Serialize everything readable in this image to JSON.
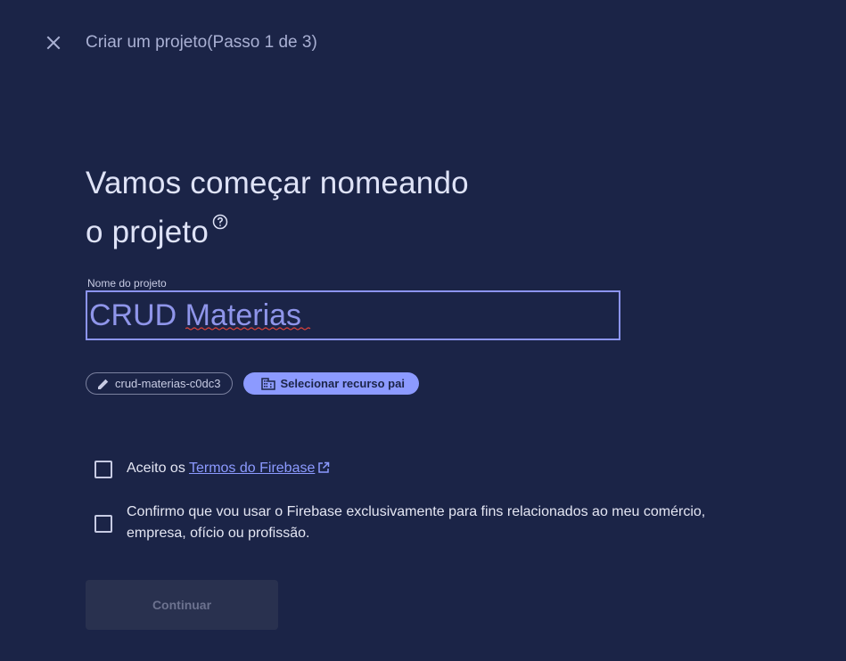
{
  "header": {
    "close_icon": "close-icon",
    "step_title": "Criar um projeto(Passo 1 de 3)"
  },
  "main": {
    "heading_line1": "Vamos começar nomeando",
    "heading_line2": "o projeto",
    "help_icon": "help-circle-icon",
    "project_name": {
      "label": "Nome do projeto",
      "value": "CRUD Materias"
    },
    "chips": {
      "project_id": "crud-materias-c0dc3",
      "project_id_icon": "pencil-icon",
      "parent_resource": "Selecionar recurso pai",
      "parent_resource_icon": "building-icon"
    },
    "terms": {
      "prefix": "Aceito os",
      "link": "Termos do Firebase",
      "link_icon": "open-external-icon"
    },
    "business_use": {
      "line1": "Confirmo que vou usar o Firebase exclusivamente para fins relacionados ao meu comércio,",
      "line2": "empresa, ofício ou profissão."
    },
    "continue_label": "Continuar"
  },
  "colors": {
    "background": "#1b2447",
    "accent": "#8c9aff",
    "input_border": "#8c94f0"
  }
}
